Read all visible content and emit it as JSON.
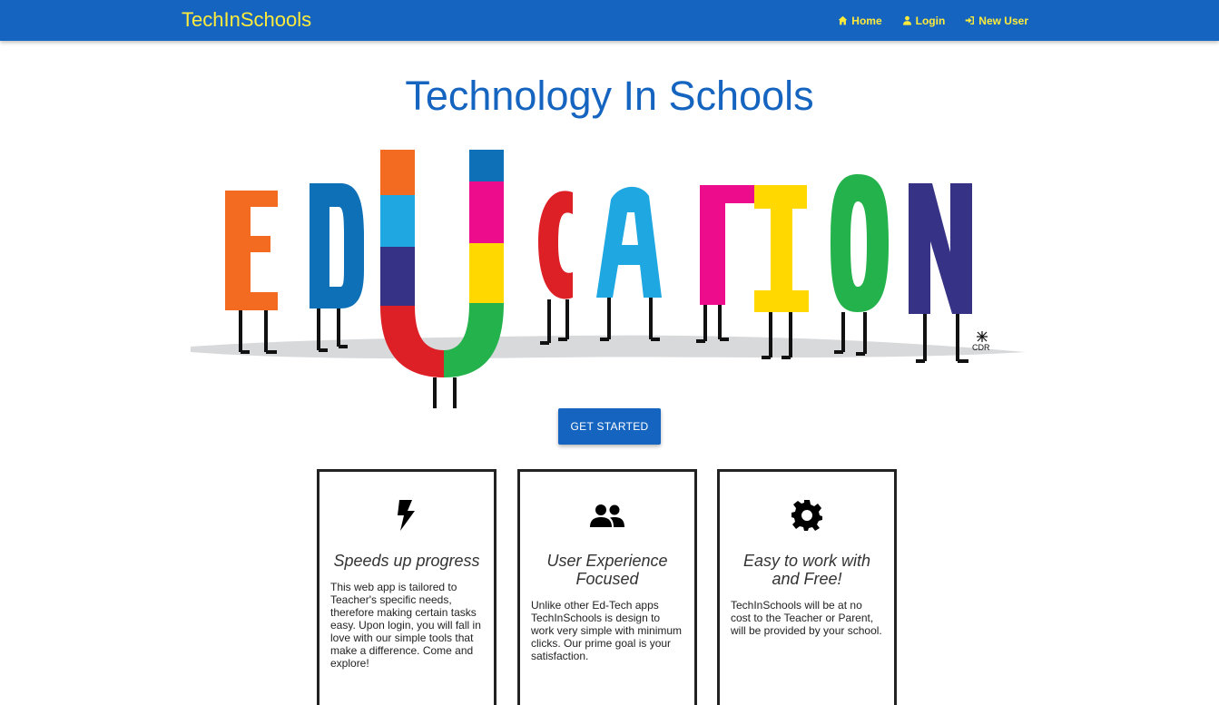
{
  "nav": {
    "brand": "TechInSchools",
    "links": [
      {
        "label": "Home",
        "icon": "home-icon"
      },
      {
        "label": "Login",
        "icon": "user-icon"
      },
      {
        "label": "New User",
        "icon": "sign-in-icon"
      }
    ]
  },
  "title": "Technology In Schools",
  "hero": {
    "letters": [
      "E",
      "D",
      "U",
      "C",
      "A",
      "T",
      "I",
      "O",
      "N"
    ],
    "signature": "CDR"
  },
  "cta_label": "GET STARTED",
  "cards": [
    {
      "icon": "lightning-bolt-icon",
      "title": "Speeds up progress",
      "text": "This web app is tailored to Teacher's specific needs, therefore making certain tasks easy. Upon login, you will fall in love with our simple tools that make a difference. Come and explore!"
    },
    {
      "icon": "people-icon",
      "title": "User Experience Focused",
      "text": "Unlike other Ed-Tech apps TechInSchools is design to work very simple with minimum clicks. Our prime goal is your satisfaction."
    },
    {
      "icon": "gear-icon",
      "title": "Easy to work with and Free!",
      "text": "TechInSchools will be at no cost to the Teacher or Parent, will be provided by your school."
    }
  ],
  "colors": {
    "primary": "#1565c0",
    "nav_text": "#ffeb3b"
  }
}
